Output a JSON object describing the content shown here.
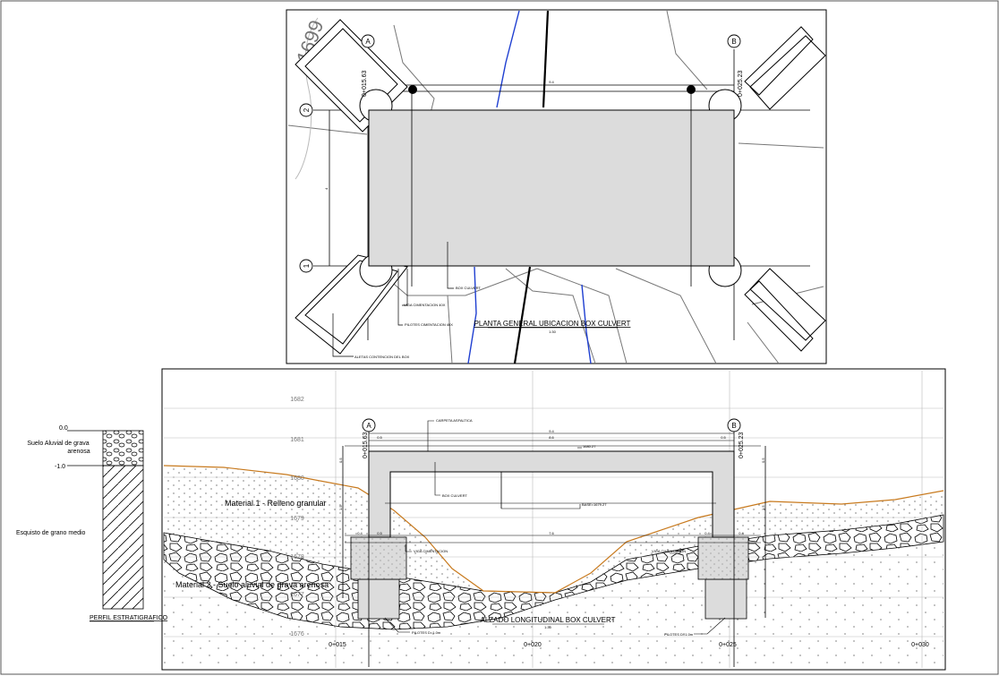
{
  "plan": {
    "title": "PLANTA GENERAL UBICACION BOX CULVERT",
    "scale": "1:30",
    "axis_a": "A",
    "axis_b": "B",
    "axis_1": "1",
    "axis_2": "2",
    "station_a": "0+015.63",
    "station_b": "0+025.23",
    "dim_top_1": "9.4",
    "dim_left": "4",
    "contour_label": "1699",
    "callouts": {
      "box": "BOX CULVERT",
      "viga": "VIGA CIMENTACION 40X",
      "pilotes": "PILOTES CIMENTACION 40X",
      "aletas": "ALETAS CONTENCION DEL BOX"
    }
  },
  "profile": {
    "title": "ALZADO LONGITUDINAL BOX CULVERT",
    "scale": "1:30",
    "axis_a": "A",
    "axis_b": "B",
    "station_a": "0+015.63",
    "station_b": "0+025.23",
    "elevations": [
      "1682",
      "1681",
      "1680",
      "1679",
      "1678",
      "1677",
      "1676"
    ],
    "stations": [
      "0+015",
      "0+020",
      "0+025",
      "0+030"
    ],
    "material_1": "Material 1 - Relleno granular",
    "material_2": "Material 2 - Suelo aluvial de grava arenosa",
    "callouts": {
      "carpeta": "CARPETA ASFALTICA",
      "box": "BOX CULVERT",
      "viga": "VIGA CIMENTACION",
      "pilotes_left": "PILOTES D=1.0m",
      "pilotes_right": "PILOTES D=1.0m",
      "top_level": "1680.27",
      "base_level": "BASE=1679.27"
    },
    "dims": {
      "total_1": "9.4",
      "total_2": "8.6",
      "wall_l": "0.5",
      "wall_r": "0.5",
      "height_l": "0.5",
      "height_r": "0.5",
      "inner_l": "1.5",
      "inner_r": "1.5",
      "clear": "7.6",
      "footing_l1": "0.4",
      "footing_l2": "0.5",
      "footing_r1": "0.4",
      "footing_r2": "0.4"
    }
  },
  "strat": {
    "title": "PERFIL ESTRATIGRAFICO",
    "depth_0": "0.0",
    "depth_1": "-1.0",
    "layer_1": [
      "Suelo Aluvial de grava",
      "arenosa"
    ],
    "layer_2": "Esquisto de grano medio"
  },
  "colors": {
    "terrain": "#c87a1e",
    "stream": "#1f3fd1",
    "concrete": "#dcdcdc"
  }
}
